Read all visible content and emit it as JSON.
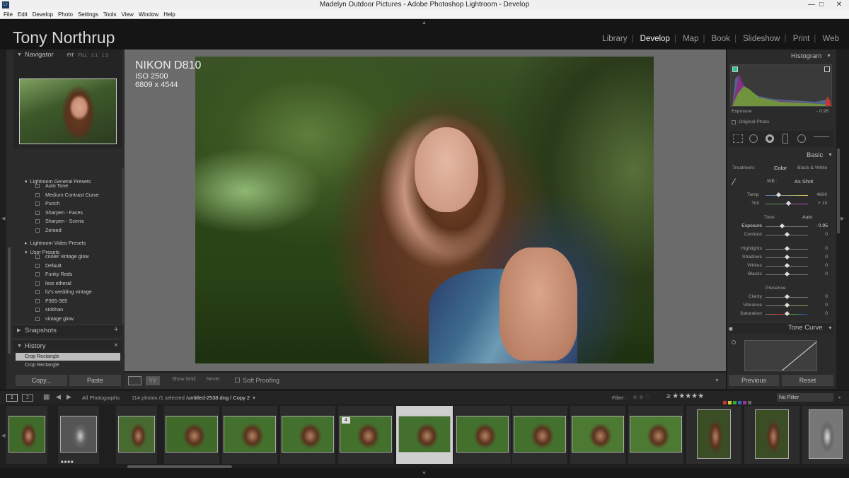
{
  "window": {
    "title": "Madelyn Outdoor Pictures - Adobe Photoshop Lightroom - Develop",
    "app_icon": "Lr",
    "min": "—",
    "max": "□",
    "close": "✕"
  },
  "menu": [
    "File",
    "Edit",
    "Develop",
    "Photo",
    "Settings",
    "Tools",
    "View",
    "Window",
    "Help"
  ],
  "identity": "Tony Northrup",
  "modules": [
    "Library",
    "Develop",
    "Map",
    "Book",
    "Slideshow",
    "Print",
    "Web"
  ],
  "active_module": "Develop",
  "navigator": {
    "title": "Navigator",
    "zoom": [
      "FIT",
      "FILL",
      "1:1",
      "1:3"
    ]
  },
  "presets": {
    "groups": [
      {
        "name": "Lightroom General Presets",
        "items": [
          "Auto Tone",
          "Medium Contrast Curve",
          "Punch",
          "Sharpen - Faces",
          "Sharpen - Scenic",
          "Zeroed"
        ]
      },
      {
        "name": "Lightroom Video Presets",
        "items": []
      },
      {
        "name": "User Presets",
        "items": [
          "cooler vintage glow",
          "Default",
          "Funky Reds",
          "less etheral",
          "liz's wedding vintage",
          "P365-365",
          "siobhan",
          "vintage glow"
        ]
      }
    ]
  },
  "snapshots": {
    "title": "Snapshots",
    "add": "+"
  },
  "history": {
    "title": "History",
    "clear": "×",
    "items": [
      "Crop Rectangle",
      "Crop Rectangle"
    ]
  },
  "left_buttons": {
    "copy": "Copy...",
    "paste": "Paste"
  },
  "photo_info": {
    "camera": "NIKON D810",
    "iso": "ISO 2500",
    "dims": "6809 x 4544"
  },
  "toolbar": {
    "show_grid_label": "Show Grid:",
    "show_grid_value": "Never",
    "soft_proofing": "Soft Proofing"
  },
  "histogram": {
    "title": "Histogram",
    "exposure_label": "Exposure",
    "exposure_value": "- 0.95",
    "original_photo": "Original Photo"
  },
  "basic": {
    "title": "Basic",
    "treatment_label": "Treatment :",
    "treatment_color": "Color",
    "treatment_bw": "Black & White",
    "wb_label": "WB :",
    "wb_value": "As Shot",
    "temp_label": "Temp",
    "temp_value": "4600",
    "tint_label": "Tint",
    "tint_value": "+ 10",
    "tone_label": "Tone",
    "auto_label": "Auto",
    "sliders": [
      {
        "label": "Exposure",
        "value": "- 0.95",
        "pos": 0.38
      },
      {
        "label": "Contrast",
        "value": "0",
        "pos": 0.5
      },
      {
        "label": "Highlights",
        "value": "0",
        "pos": 0.5
      },
      {
        "label": "Shadows",
        "value": "0",
        "pos": 0.5
      },
      {
        "label": "Whites",
        "value": "0",
        "pos": 0.5
      },
      {
        "label": "Blacks",
        "value": "0",
        "pos": 0.5
      }
    ],
    "presence_label": "Presence",
    "presence": [
      {
        "label": "Clarity",
        "value": "0",
        "pos": 0.5
      },
      {
        "label": "Vibrance",
        "value": "0",
        "pos": 0.5
      },
      {
        "label": "Saturation",
        "value": "0",
        "pos": 0.5
      }
    ]
  },
  "tone_curve": {
    "title": "Tone Curve"
  },
  "right_buttons": {
    "previous": "Previous",
    "reset": "Reset"
  },
  "filmstrip": {
    "screen1": "1",
    "screen2": "2",
    "source": "All Photographs",
    "count": "114 photos /1 selected /",
    "filename": "untitled-2538.dng / Copy 2",
    "filter_label": "Filter :",
    "no_filter": "No Filter",
    "badge": "4",
    "stars": "≥ ★★★★★"
  }
}
